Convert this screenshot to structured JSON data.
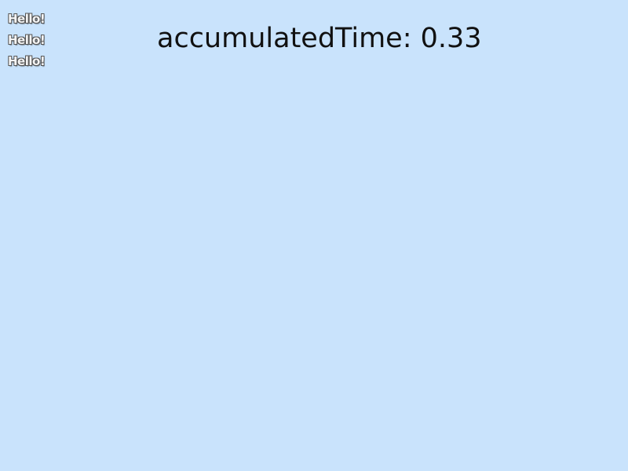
{
  "hello_lines": [
    "Hello!",
    "Hello!",
    "Hello!"
  ],
  "timer": {
    "label": "accumulatedTime: 0.33",
    "value": 0.33
  },
  "colors": {
    "background": "#c9e3fc",
    "timer_text": "#111111",
    "hello_text": "#f4f4f4",
    "hello_outline": "#555555"
  }
}
